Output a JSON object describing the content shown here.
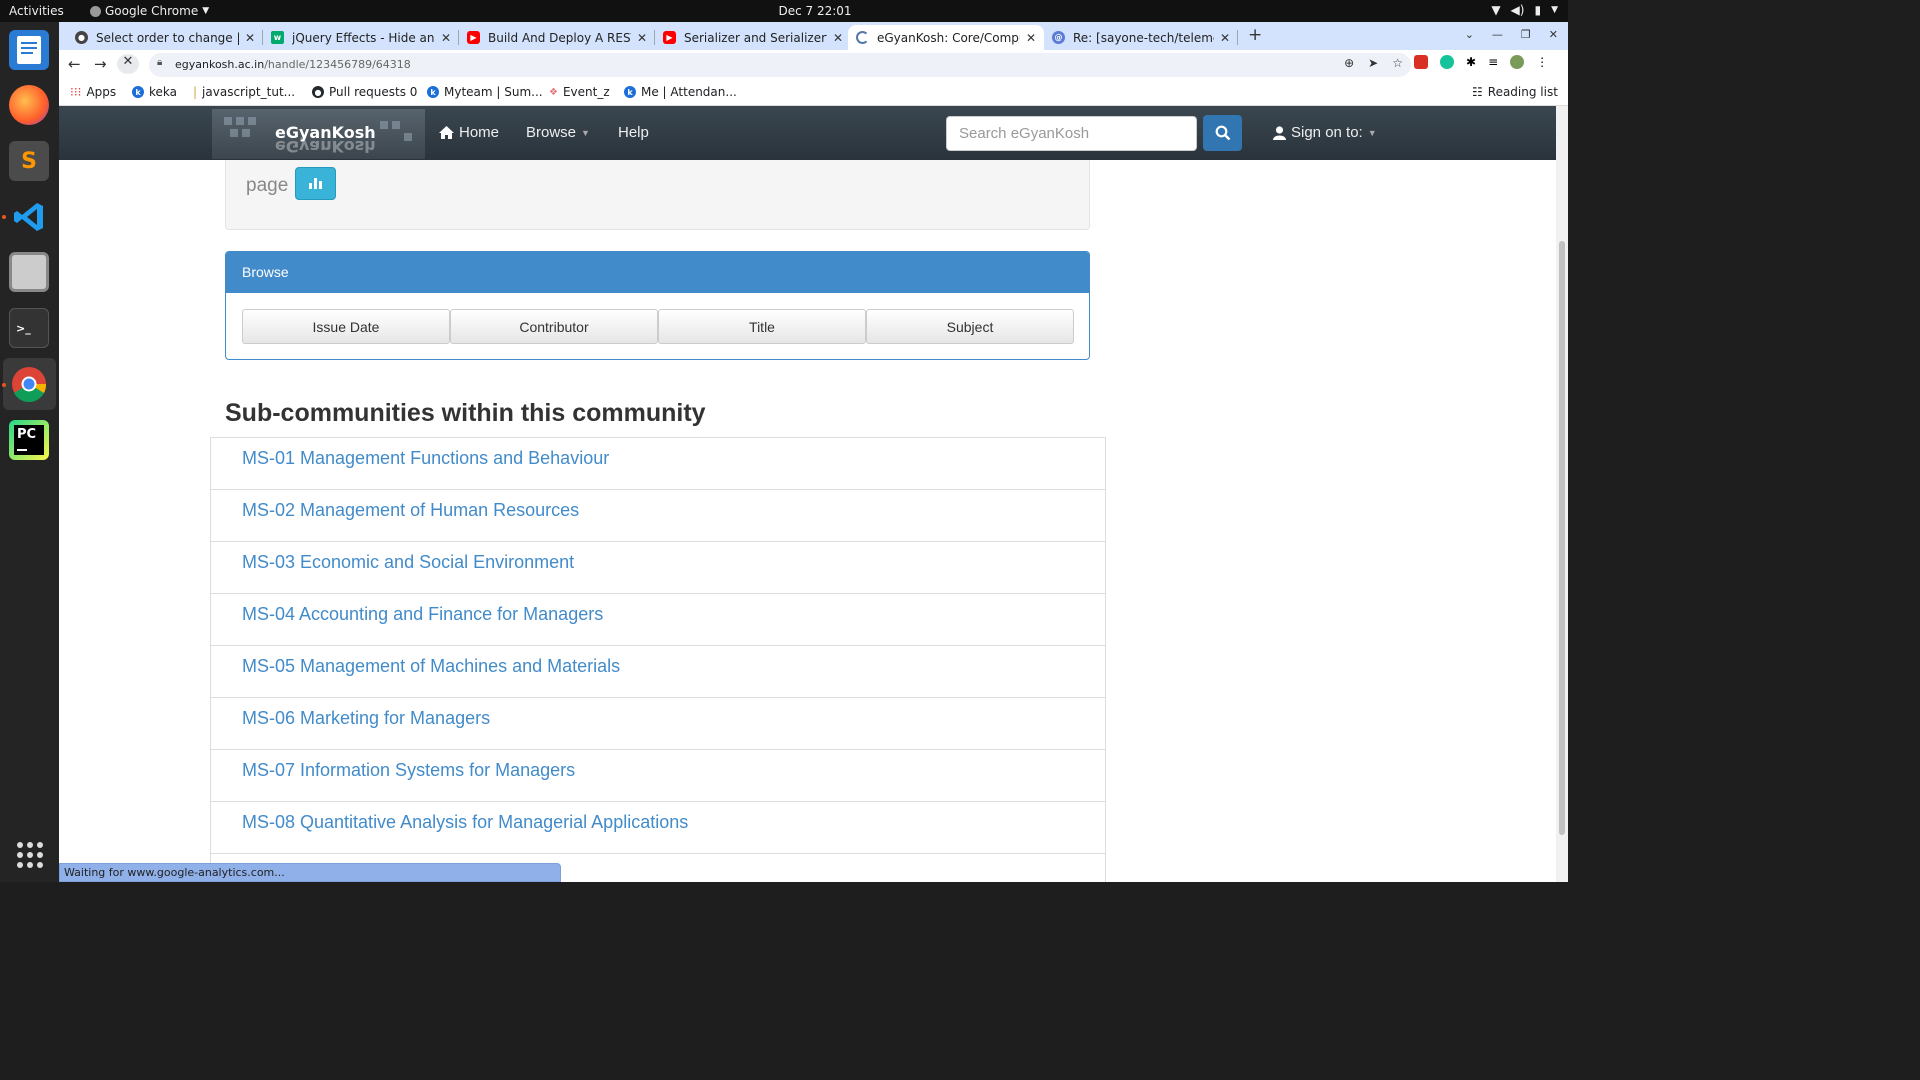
{
  "system": {
    "activities": "Activities",
    "app_name": "Google Chrome",
    "clock": "Dec 7  22:01"
  },
  "tabs": [
    {
      "title": "Select order to change | D",
      "favicon_color": "#444"
    },
    {
      "title": "jQuery Effects - Hide and",
      "favicon_color": "#04aa6d"
    },
    {
      "title": "Build And Deploy A REST A",
      "favicon_color": "#ff0000"
    },
    {
      "title": "Serializer and Serializertic",
      "favicon_color": "#ff0000"
    },
    {
      "title": "eGyanKosh: Core/Comput",
      "favicon_color": "#5577aa"
    },
    {
      "title": "Re: [sayone-tech/telemed",
      "favicon_color": "#5a7bd6"
    }
  ],
  "address": {
    "host": "egyankosh.ac.in",
    "path": "/handle/123456789/64318"
  },
  "bookmarks": [
    {
      "label": "Apps",
      "icon": "apps-grid-icon"
    },
    {
      "label": "keka",
      "icon": "keka-icon"
    },
    {
      "label": "javascript_tut...",
      "icon": "bookmark-icon"
    },
    {
      "label": "Pull requests 0",
      "icon": "github-icon"
    },
    {
      "label": "Myteam | Sum...",
      "icon": "keka-icon"
    },
    {
      "label": "Event_z",
      "icon": "event-icon"
    },
    {
      "label": "Me | Attendan...",
      "icon": "keka-icon"
    }
  ],
  "reading_list": "Reading list",
  "site": {
    "logo_text": "eGyanKosh",
    "nav": {
      "home": "Home",
      "browse": "Browse",
      "help": "Help",
      "signin": "Sign on to:"
    },
    "search_placeholder": "Search eGyanKosh"
  },
  "content": {
    "stats_label": "page",
    "browse_panel": {
      "title": "Browse",
      "buttons": [
        "Issue Date",
        "Contributor",
        "Title",
        "Subject"
      ]
    },
    "subcommunities_heading": "Sub-communities within this community",
    "subcommunities": [
      "MS-01 Management Functions and Behaviour",
      "MS-02 Management of Human Resources",
      "MS-03 Economic and Social Environment",
      "MS-04 Accounting and Finance for Managers",
      "MS-05 Management of Machines and Materials",
      "MS-06 Marketing for Managers",
      "MS-07 Information Systems for Managers",
      "MS-08 Quantitative Analysis for Managerial Applications"
    ]
  },
  "status_bar": "Waiting for www.google-analytics.com..."
}
